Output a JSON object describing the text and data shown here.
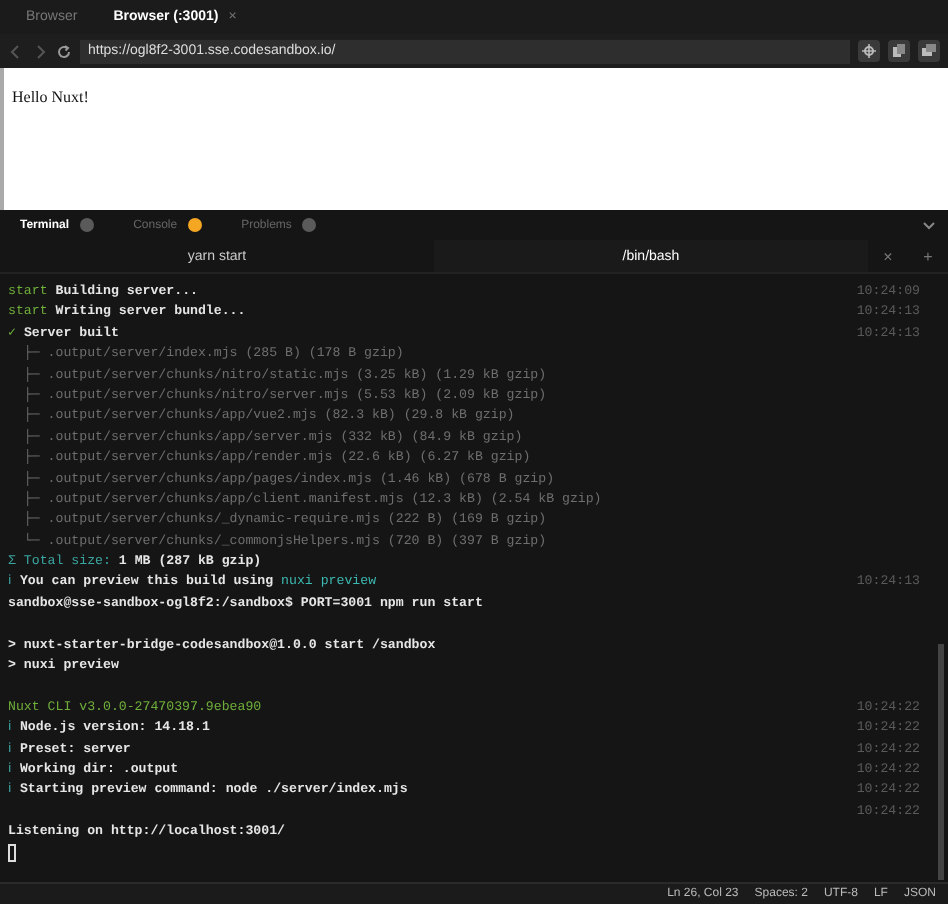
{
  "browser_tabs": [
    {
      "label": "Browser",
      "selected": false
    },
    {
      "label": "Browser (:3001)",
      "selected": true,
      "close": "×"
    }
  ],
  "address_bar": {
    "url": "https://ogl8f2-3001.sse.codesandbox.io/"
  },
  "page": {
    "text": "Hello Nuxt!"
  },
  "panel_tabs": [
    {
      "label": "Terminal",
      "selected": true,
      "color": "#5a5a5a"
    },
    {
      "label": "Console",
      "selected": false,
      "color": "#f5a623"
    },
    {
      "label": "Problems",
      "selected": false,
      "color": "#5a5a5a"
    }
  ],
  "terminal_tabs": [
    {
      "label": "yarn start",
      "selected": false
    },
    {
      "label": "/bin/bash",
      "selected": true
    }
  ],
  "terminal_actions": [
    "×",
    "+"
  ],
  "terminal_lines": [
    {
      "kind": "text",
      "segments": [
        {
          "text": "start",
          "kind": "success"
        },
        {
          "text": " Building server...",
          "kind": "plain"
        }
      ],
      "time": "10:24:09"
    },
    {
      "kind": "text",
      "segments": [
        {
          "text": "start",
          "kind": "success"
        },
        {
          "text": " Writing server bundle...",
          "kind": "plain"
        }
      ],
      "time": "10:24:13"
    },
    {
      "kind": "text",
      "segments": [
        {
          "text": "✓",
          "kind": "success"
        },
        {
          "text": " Server built",
          "kind": "plain"
        }
      ],
      "time": "10:24:13"
    },
    {
      "kind": "text",
      "segments": [
        {
          "text": "  ├─ .output/server/index.mjs (285 B) (178 B gzip)",
          "kind": "muted"
        }
      ]
    },
    {
      "kind": "text",
      "segments": [
        {
          "text": "  ├─ .output/server/chunks/nitro/static.mjs (3.25 kB) (1.29 kB gzip)",
          "kind": "muted"
        }
      ]
    },
    {
      "kind": "text",
      "segments": [
        {
          "text": "  ├─ .output/server/chunks/nitro/server.mjs (5.53 kB) (2.09 kB gzip)",
          "kind": "muted"
        }
      ]
    },
    {
      "kind": "text",
      "segments": [
        {
          "text": "  ├─ .output/server/chunks/app/vue2.mjs (82.3 kB) (29.8 kB gzip)",
          "kind": "muted"
        }
      ]
    },
    {
      "kind": "text",
      "segments": [
        {
          "text": "  ├─ .output/server/chunks/app/server.mjs (332 kB) (84.9 kB gzip)",
          "kind": "muted"
        }
      ]
    },
    {
      "kind": "text",
      "segments": [
        {
          "text": "  ├─ .output/server/chunks/app/render.mjs (22.6 kB) (6.27 kB gzip)",
          "kind": "muted"
        }
      ]
    },
    {
      "kind": "text",
      "segments": [
        {
          "text": "  ├─ .output/server/chunks/app/pages/index.mjs (1.46 kB) (678 B gzip)",
          "kind": "muted"
        }
      ]
    },
    {
      "kind": "text",
      "segments": [
        {
          "text": "  ├─ .output/server/chunks/app/client.manifest.mjs (12.3 kB) (2.54 kB gzip)",
          "kind": "muted"
        }
      ]
    },
    {
      "kind": "text",
      "segments": [
        {
          "text": "  ├─ .output/server/chunks/_dynamic-require.mjs (222 B) (169 B gzip)",
          "kind": "muted"
        }
      ]
    },
    {
      "kind": "text",
      "segments": [
        {
          "text": "  └─ .output/server/chunks/_commonjsHelpers.mjs (720 B) (397 B gzip)",
          "kind": "muted"
        }
      ]
    },
    {
      "kind": "text",
      "segments": [
        {
          "text": "Σ Total size:",
          "kind": "info"
        },
        {
          "text": " 1 MB (287 kB gzip)",
          "kind": "plain"
        }
      ]
    },
    {
      "kind": "text",
      "segments": [
        {
          "text": "ℹ",
          "kind": "info"
        },
        {
          "text": " You can preview this build using ",
          "kind": "plain"
        },
        {
          "text": "nuxi preview",
          "kind": "link"
        }
      ],
      "time": "10:24:13"
    },
    {
      "kind": "text",
      "segments": [
        {
          "text": "sandbox@sse-sandbox-ogl8f2:/sandbox$ PORT=3001 npm run start",
          "kind": "plain"
        }
      ]
    },
    {
      "kind": "blank"
    },
    {
      "kind": "text",
      "segments": [
        {
          "text": "> nuxt-starter-bridge-codesandbox@1.0.0 start /sandbox",
          "kind": "plain"
        }
      ]
    },
    {
      "kind": "text",
      "segments": [
        {
          "text": "> nuxi preview",
          "kind": "plain"
        }
      ]
    },
    {
      "kind": "blank"
    },
    {
      "kind": "text",
      "segments": [
        {
          "text": "Nuxt CLI v3.0.0-27470397.9ebea90",
          "kind": "success"
        }
      ],
      "time": "10:24:22"
    },
    {
      "kind": "text",
      "segments": [
        {
          "text": "ℹ",
          "kind": "info"
        },
        {
          "text": " Node.js version: 14.18.1",
          "kind": "plain"
        }
      ],
      "time": "10:24:22"
    },
    {
      "kind": "text",
      "segments": [
        {
          "text": "ℹ",
          "kind": "info"
        },
        {
          "text": " Preset: server",
          "kind": "plain"
        }
      ],
      "time": "10:24:22"
    },
    {
      "kind": "text",
      "segments": [
        {
          "text": "ℹ",
          "kind": "info"
        },
        {
          "text": " Working dir: .output",
          "kind": "plain"
        }
      ],
      "time": "10:24:22"
    },
    {
      "kind": "text",
      "segments": [
        {
          "text": "ℹ",
          "kind": "info"
        },
        {
          "text": " Starting preview command: node ./server/index.mjs",
          "kind": "plain"
        }
      ],
      "time": "10:24:22"
    },
    {
      "kind": "blank",
      "time": "10:24:22"
    },
    {
      "kind": "text",
      "segments": [
        {
          "text": "Listening on http://localhost:3001/",
          "kind": "plain"
        }
      ]
    },
    {
      "kind": "cursor"
    }
  ],
  "status_bar": [
    "Ln 26, Col 23",
    "Spaces: 2",
    "UTF-8",
    "LF",
    "JSON"
  ]
}
